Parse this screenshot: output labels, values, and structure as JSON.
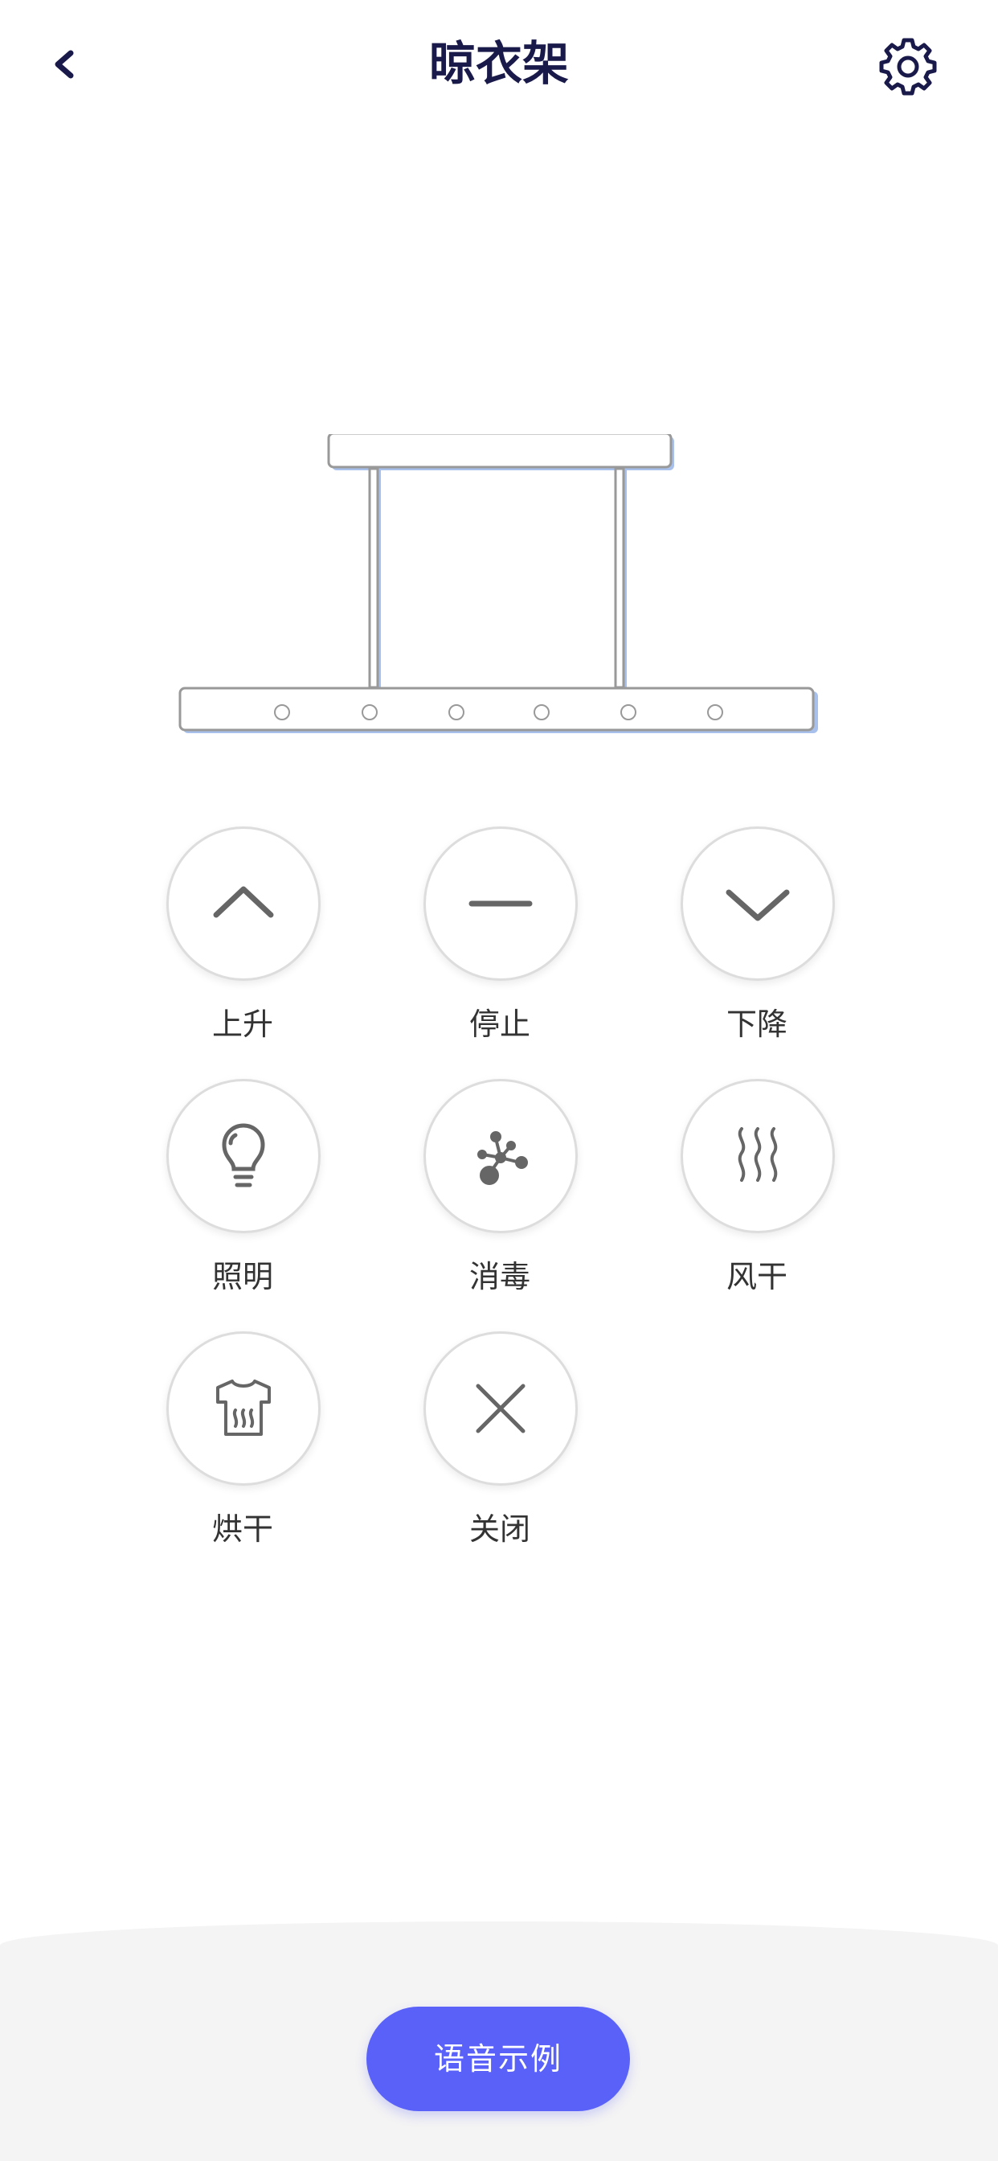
{
  "header": {
    "title": "晾衣架",
    "back_icon": "chevron-left-icon",
    "settings_icon": "gear-icon"
  },
  "colors": {
    "title": "#1a1a4a",
    "accent": "#5961f9",
    "icon": "#666666",
    "rack_outline": "#999999",
    "rack_shadow": "#a8c0ec"
  },
  "controls": [
    {
      "label": "上升",
      "icon": "chevron-up-icon"
    },
    {
      "label": "停止",
      "icon": "minus-icon"
    },
    {
      "label": "下降",
      "icon": "chevron-down-icon"
    },
    {
      "label": "照明",
      "icon": "light-bulb-icon"
    },
    {
      "label": "消毒",
      "icon": "disinfect-icon"
    },
    {
      "label": "风干",
      "icon": "air-dry-icon"
    },
    {
      "label": "烘干",
      "icon": "shirt-heat-icon"
    },
    {
      "label": "关闭",
      "icon": "close-icon"
    }
  ],
  "footer": {
    "voice_button_label": "语音示例"
  }
}
